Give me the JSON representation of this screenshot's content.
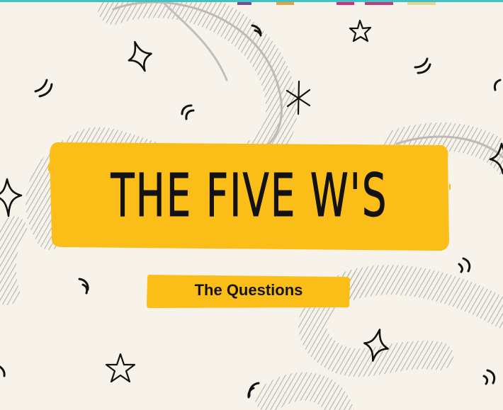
{
  "slide": {
    "title": "THE FIVE W'S",
    "subtitle": "The Questions"
  },
  "colors": {
    "background": "#f7f3ea",
    "accent": "#fbbd17",
    "scribble": "#b9b7b2",
    "ink": "#111111",
    "frame": "#41c2c7"
  },
  "decorations": [
    "four-point-star-icon",
    "five-point-star-icon",
    "asterisk-icon",
    "double-tick-mark-icon",
    "scribble-swirl"
  ]
}
